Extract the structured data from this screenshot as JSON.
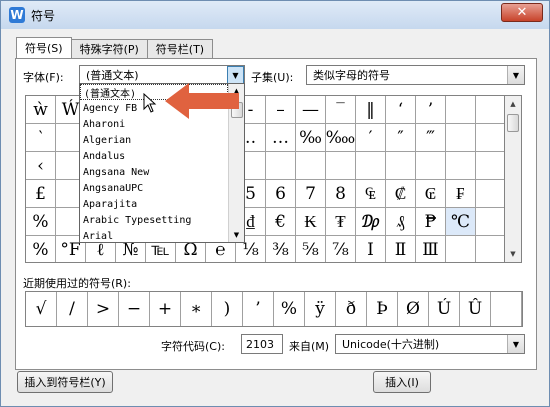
{
  "window": {
    "title": "符号",
    "close_glyph": "✕",
    "app_icon": "W"
  },
  "tabs": [
    "符号(S)",
    "特殊字符(P)",
    "符号栏(T)"
  ],
  "font": {
    "label": "字体(F):",
    "value": "(普通文本)"
  },
  "subset": {
    "label": "子集(U):",
    "value": "类似字母的符号"
  },
  "dropdown_items": [
    "(普通文本)",
    "Agency FB",
    "Aharoni",
    "Algerian",
    "Andalus",
    "Angsana New",
    "AngsanaUPC",
    "Aparajita",
    "Arabic Typesetting",
    "Arial"
  ],
  "symbol_rows": [
    [
      "ẁ",
      "Ẃ",
      "",
      "",
      "",
      "",
      "",
      "-",
      "–",
      "—",
      "‾",
      "‖",
      "‘",
      "’",
      "",
      ""
    ],
    [
      "‵",
      "",
      "",
      "",
      "",
      "",
      "",
      "‥",
      "…",
      "‰",
      "‱",
      "′",
      "″",
      "‴",
      "",
      ""
    ],
    [
      "‹",
      "",
      "",
      "",
      "",
      "",
      "",
      "",
      "",
      "",
      "",
      "",
      "",
      "",
      "",
      ""
    ],
    [
      "£",
      "",
      "",
      "",
      "",
      "",
      "",
      "5",
      "6",
      "7",
      "8",
      "₠",
      "₡",
      "₢",
      "₣",
      ""
    ],
    [
      "%",
      "",
      "",
      "",
      "",
      "",
      "",
      "₫",
      "€",
      "₭",
      "₮",
      "₯",
      "₰",
      "₱",
      "℃",
      ""
    ],
    [
      "%",
      "°F",
      "ℓ",
      "№",
      "℡",
      "Ω",
      "℮",
      "⅛",
      "⅜",
      "⅝",
      "⅞",
      "Ⅰ",
      "Ⅱ",
      "Ⅲ",
      "",
      ""
    ]
  ],
  "recent": {
    "label": "近期使用过的符号(R):",
    "symbols": [
      "√",
      "/",
      ">",
      "−",
      "+",
      "∗",
      ")",
      "’",
      "%",
      "ÿ",
      "ð",
      "Þ",
      "Ø",
      "Ú",
      "Û",
      ""
    ]
  },
  "char_code": {
    "label": "字符代码(C):",
    "value": "2103"
  },
  "from": {
    "label": "来自(M)",
    "value": "Unicode(十六进制)"
  },
  "buttons": {
    "insert_to_bar": "插入到符号栏(Y)",
    "insert": "插入(I)"
  },
  "colors": {
    "arrow": "#e0623f",
    "selected_cell": "#dce9f9",
    "title_bg": "#c6d8ee"
  }
}
